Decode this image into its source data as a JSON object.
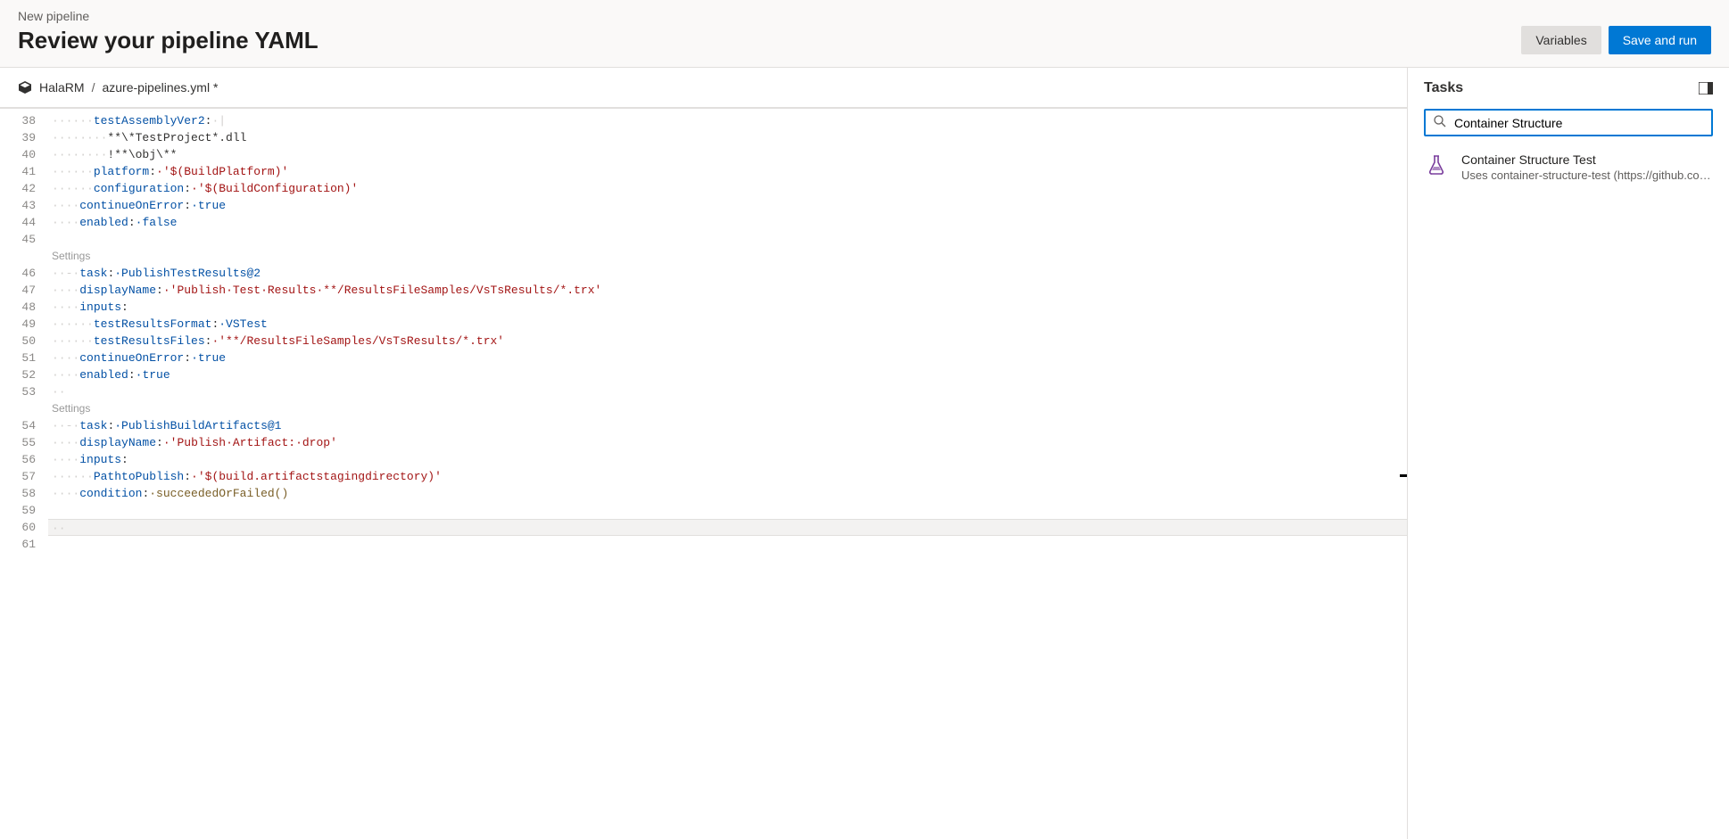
{
  "header": {
    "subtitle": "New pipeline",
    "title": "Review your pipeline YAML",
    "variables_btn": "Variables",
    "save_run_btn": "Save and run"
  },
  "breadcrumb": {
    "repo": "HalaRM",
    "sep": "/",
    "file": "azure-pipelines.yml *"
  },
  "codelens": {
    "settings": "Settings"
  },
  "code": {
    "l38": {
      "indent": "······",
      "k": "testAssemblyVer2",
      "colon": ":",
      "after": "·|"
    },
    "l39": {
      "indent": "········",
      "t": "**\\*TestProject*.dll"
    },
    "l40": {
      "indent": "········",
      "t": "!**\\obj\\**"
    },
    "l41": {
      "indent": "······",
      "k": "platform",
      "colon": ":",
      "v": "·'$(BuildPlatform)'"
    },
    "l42": {
      "indent": "······",
      "k": "configuration",
      "colon": ":",
      "v": "·'$(BuildConfiguration)'"
    },
    "l43": {
      "indent": "····",
      "k": "continueOnError",
      "colon": ":",
      "v": "·true"
    },
    "l44": {
      "indent": "····",
      "k": "enabled",
      "colon": ":",
      "v": "·false"
    },
    "l45": {
      "t": ""
    },
    "l46": {
      "indent": "··",
      "dash": "-·",
      "k": "task",
      "colon": ":",
      "v": "·PublishTestResults@2"
    },
    "l47": {
      "indent": "····",
      "k": "displayName",
      "colon": ":",
      "v": "·'Publish·Test·Results·**/ResultsFileSamples/VsTsResults/*.trx'"
    },
    "l48": {
      "indent": "····",
      "k": "inputs",
      "colon": ":"
    },
    "l49": {
      "indent": "······",
      "k": "testResultsFormat",
      "colon": ":",
      "v": "·VSTest"
    },
    "l50": {
      "indent": "······",
      "k": "testResultsFiles",
      "colon": ":",
      "v": "·'**/ResultsFileSamples/VsTsResults/*.trx'"
    },
    "l51": {
      "indent": "····",
      "k": "continueOnError",
      "colon": ":",
      "v": "·true"
    },
    "l52": {
      "indent": "····",
      "k": "enabled",
      "colon": ":",
      "v": "·true"
    },
    "l53": {
      "t": "··"
    },
    "l54": {
      "indent": "··",
      "dash": "-·",
      "k": "task",
      "colon": ":",
      "v": "·PublishBuildArtifacts@1"
    },
    "l55": {
      "indent": "····",
      "k": "displayName",
      "colon": ":",
      "v": "·'Publish·Artifact:·drop'"
    },
    "l56": {
      "indent": "····",
      "k": "inputs",
      "colon": ":"
    },
    "l57": {
      "indent": "······",
      "k": "PathtoPublish",
      "colon": ":",
      "v": "·'$(build.artifactstagingdirectory)'"
    },
    "l58": {
      "indent": "····",
      "k": "condition",
      "colon": ":",
      "fn": "·succeededOrFailed()"
    },
    "l59": {
      "t": ""
    },
    "l60": {
      "t": "··"
    },
    "l61": {
      "t": ""
    }
  },
  "line_numbers": [
    "38",
    "39",
    "40",
    "41",
    "42",
    "43",
    "44",
    "45",
    "",
    "46",
    "47",
    "48",
    "49",
    "50",
    "51",
    "52",
    "53",
    "",
    "54",
    "55",
    "56",
    "57",
    "58",
    "59",
    "60",
    "61"
  ],
  "tasks": {
    "title": "Tasks",
    "search_value": "Container Structure",
    "result": {
      "name": "Container Structure Test",
      "desc": "Uses container-structure-test (https://github.com…"
    }
  }
}
